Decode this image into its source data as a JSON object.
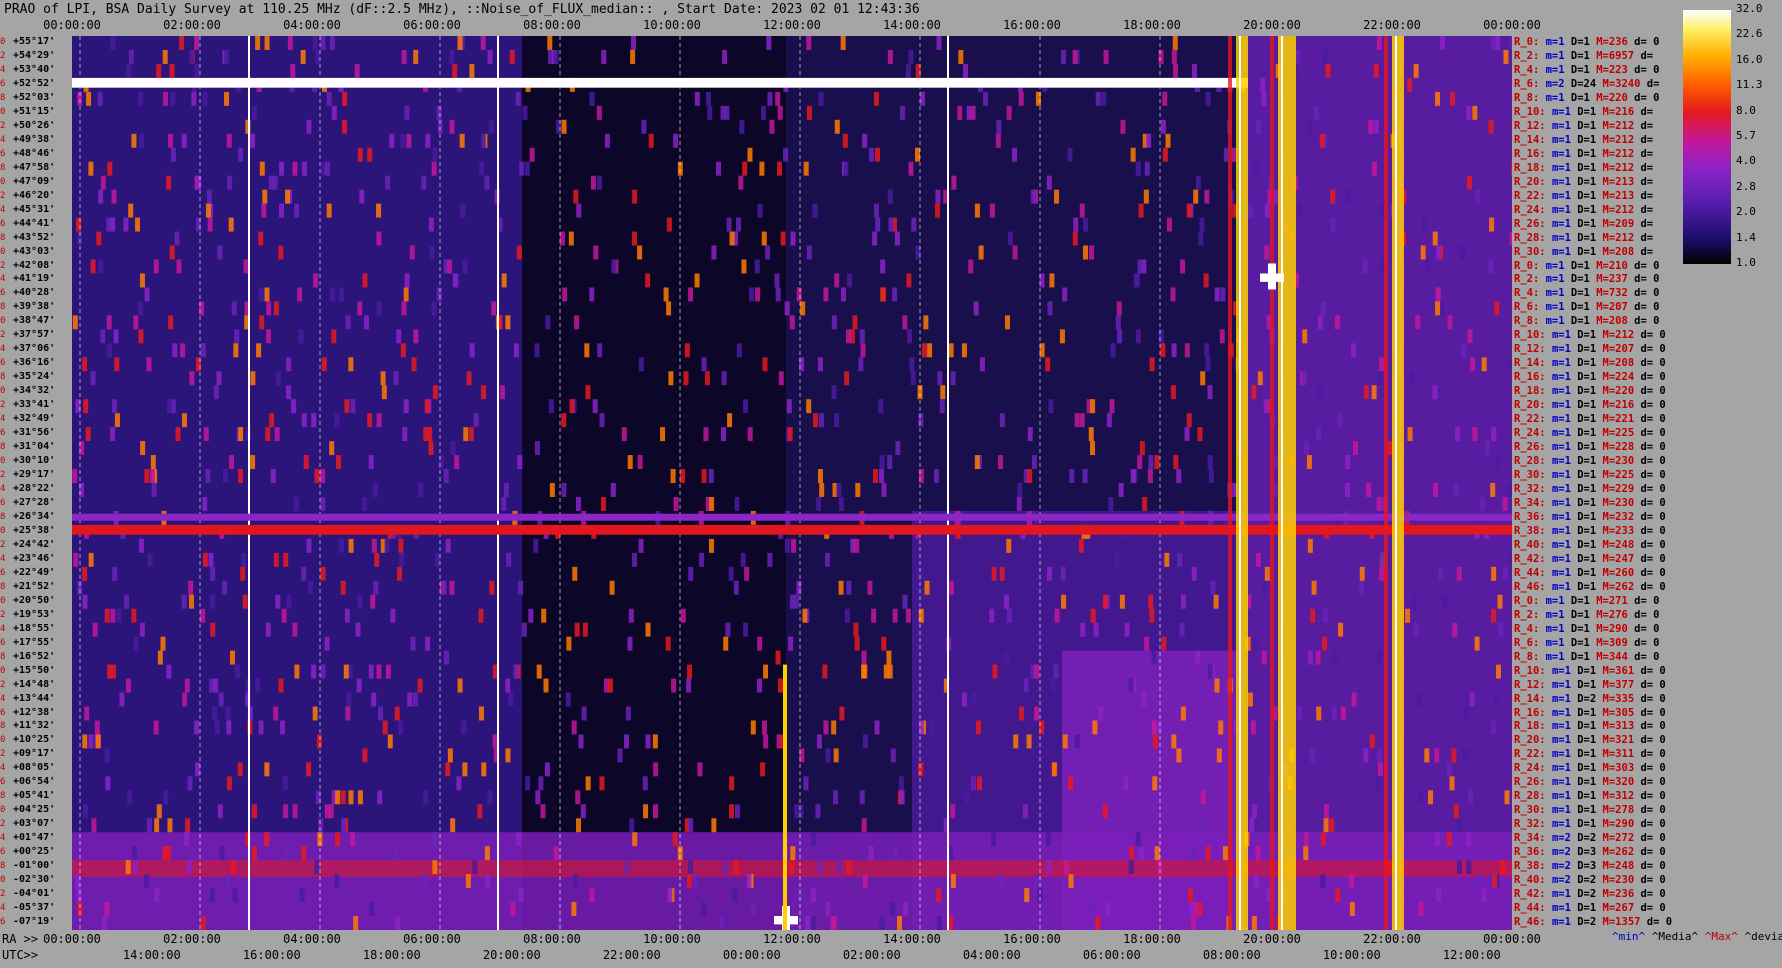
{
  "title": "PRAO of LPI, BSA Daily Survey at 110.25 MHz (dF::2.5 MHz), ::Noise_of_FLUX_median:: , Start Date: 2023 02 01 12:43:36",
  "top_ticks": [
    "00:00:00",
    "02:00:00",
    "04:00:00",
    "06:00:00",
    "08:00:00",
    "10:00:00",
    "12:00:00",
    "14:00:00",
    "16:00:00",
    "18:00:00",
    "20:00:00",
    "22:00:00",
    "00:00:00"
  ],
  "ra_label": "RA >>",
  "ra_ticks": [
    "00:00:00",
    "02:00:00",
    "04:00:00",
    "06:00:00",
    "08:00:00",
    "10:00:00",
    "12:00:00",
    "14:00:00",
    "16:00:00",
    "18:00:00",
    "20:00:00",
    "22:00:00",
    "00:00:00"
  ],
  "utc_label": "UTC>>",
  "utc_ticks": [
    "14:00:00",
    "16:00:00",
    "18:00:00",
    "20:00:00",
    "22:00:00",
    "00:00:00",
    "02:00:00",
    "04:00:00",
    "06:00:00",
    "08:00:00",
    "10:00:00",
    "12:00:00"
  ],
  "colorbar": {
    "labels": [
      "32.0",
      "22.6",
      "16.0",
      "11.3",
      "8.0",
      "5.7",
      "4.0",
      "2.8",
      "2.0",
      "1.4",
      "1.0"
    ]
  },
  "legend": {
    "min": "^min^",
    "median": "^Media^",
    "max": "^Max^",
    "dev": "^devia^"
  },
  "declinations": [
    "+55°17'",
    "+54°29'",
    "+53°40'",
    "+52°52'",
    "+52°03'",
    "+51°15'",
    "+50°26'",
    "+49°38'",
    "+48°46'",
    "+47°58'",
    "+47°09'",
    "+46°20'",
    "+45°31'",
    "+44°41'",
    "+43°52'",
    "+43°03'",
    "+42°08'",
    "+41°19'",
    "+40°28'",
    "+39°38'",
    "+38°47'",
    "+37°57'",
    "+37°06'",
    "+36°16'",
    "+35°24'",
    "+34°32'",
    "+33°41'",
    "+32°49'",
    "+31°56'",
    "+31°04'",
    "+30°10'",
    "+29°17'",
    "+28°22'",
    "+27°28'",
    "+26°34'",
    "+25°38'",
    "+24°42'",
    "+23°46'",
    "+22°49'",
    "+21°52'",
    "+20°50'",
    "+19°53'",
    "+18°55'",
    "+17°55'",
    "+16°52'",
    "+15°50'",
    "+14°48'",
    "+13°44'",
    "+12°38'",
    "+11°32'",
    "+10°25'",
    "+09°17'",
    "+08°05'",
    "+06°54'",
    "+05°41'",
    "+04°25'",
    "+03°07'",
    "+01°47'",
    "+00°25'",
    "-01°00'",
    "-02°30'",
    "-04°01'",
    "-05°37'",
    "-07°19'"
  ],
  "dec_indices": [
    "0",
    "2",
    "4",
    "6",
    "8",
    "0",
    "2",
    "4",
    "6",
    "8",
    "0",
    "2",
    "4",
    "6",
    "8",
    "0",
    "2",
    "4",
    "6",
    "8",
    "0",
    "2",
    "4",
    "6",
    "8",
    "0",
    "2",
    "4",
    "6",
    "8",
    "0",
    "2",
    "4",
    "6",
    "8",
    "0",
    "2",
    "4",
    "6",
    "8",
    "0",
    "2",
    "4",
    "6",
    "8",
    "0",
    "2",
    "4",
    "6",
    "8",
    "0",
    "2",
    "4",
    "6",
    "8",
    "0",
    "2",
    "4",
    "6",
    "8",
    "0",
    "2",
    "4",
    "6"
  ],
  "stats": [
    {
      "r": "R_0:",
      "m": "m=1",
      "d": "D=1",
      "h": "M=236",
      "dv": "d= 0"
    },
    {
      "r": "R_2:",
      "m": "m=1",
      "d": "D=1",
      "h": "M=6957",
      "dv": "d="
    },
    {
      "r": "R_4:",
      "m": "m=1",
      "d": "D=1",
      "h": "M=223",
      "dv": "d= 0"
    },
    {
      "r": "R_6:",
      "m": "m=2",
      "d": "D=24",
      "h": "M=3240",
      "dv": "d="
    },
    {
      "r": "R_8:",
      "m": "m=1",
      "d": "D=1",
      "h": "M=220",
      "dv": "d= 0"
    },
    {
      "r": "R_10:",
      "m": "m=1",
      "d": "D=1",
      "h": "M=216",
      "dv": "d="
    },
    {
      "r": "R_12:",
      "m": "m=1",
      "d": "D=1",
      "h": "M=212",
      "dv": "d="
    },
    {
      "r": "R_14:",
      "m": "m=1",
      "d": "D=1",
      "h": "M=212",
      "dv": "d="
    },
    {
      "r": "R_16:",
      "m": "m=1",
      "d": "D=1",
      "h": "M=212",
      "dv": "d="
    },
    {
      "r": "R_18:",
      "m": "m=1",
      "d": "D=1",
      "h": "M=212",
      "dv": "d="
    },
    {
      "r": "R_20:",
      "m": "m=1",
      "d": "D=1",
      "h": "M=213",
      "dv": "d="
    },
    {
      "r": "R_22:",
      "m": "m=1",
      "d": "D=1",
      "h": "M=213",
      "dv": "d="
    },
    {
      "r": "R_24:",
      "m": "m=1",
      "d": "D=1",
      "h": "M=212",
      "dv": "d="
    },
    {
      "r": "R_26:",
      "m": "m=1",
      "d": "D=1",
      "h": "M=209",
      "dv": "d="
    },
    {
      "r": "R_28:",
      "m": "m=1",
      "d": "D=1",
      "h": "M=212",
      "dv": "d="
    },
    {
      "r": "R_30:",
      "m": "m=1",
      "d": "D=1",
      "h": "M=208",
      "dv": "d="
    },
    {
      "r": "R_0:",
      "m": "m=1",
      "d": "D=1",
      "h": "M=210",
      "dv": "d= 0"
    },
    {
      "r": "R_2:",
      "m": "m=1",
      "d": "D=1",
      "h": "M=237",
      "dv": "d= 0"
    },
    {
      "r": "R_4:",
      "m": "m=1",
      "d": "D=1",
      "h": "M=732",
      "dv": "d= 0"
    },
    {
      "r": "R_6:",
      "m": "m=1",
      "d": "D=1",
      "h": "M=207",
      "dv": "d= 0"
    },
    {
      "r": "R_8:",
      "m": "m=1",
      "d": "D=1",
      "h": "M=208",
      "dv": "d= 0"
    },
    {
      "r": "R_10:",
      "m": "m=1",
      "d": "D=1",
      "h": "M=212",
      "dv": "d= 0"
    },
    {
      "r": "R_12:",
      "m": "m=1",
      "d": "D=1",
      "h": "M=207",
      "dv": "d= 0"
    },
    {
      "r": "R_14:",
      "m": "m=1",
      "d": "D=1",
      "h": "M=208",
      "dv": "d= 0"
    },
    {
      "r": "R_16:",
      "m": "m=1",
      "d": "D=1",
      "h": "M=224",
      "dv": "d= 0"
    },
    {
      "r": "R_18:",
      "m": "m=1",
      "d": "D=1",
      "h": "M=220",
      "dv": "d= 0"
    },
    {
      "r": "R_20:",
      "m": "m=1",
      "d": "D=1",
      "h": "M=216",
      "dv": "d= 0"
    },
    {
      "r": "R_22:",
      "m": "m=1",
      "d": "D=1",
      "h": "M=221",
      "dv": "d= 0"
    },
    {
      "r": "R_24:",
      "m": "m=1",
      "d": "D=1",
      "h": "M=225",
      "dv": "d= 0"
    },
    {
      "r": "R_26:",
      "m": "m=1",
      "d": "D=1",
      "h": "M=228",
      "dv": "d= 0"
    },
    {
      "r": "R_28:",
      "m": "m=1",
      "d": "D=1",
      "h": "M=230",
      "dv": "d= 0"
    },
    {
      "r": "R_30:",
      "m": "m=1",
      "d": "D=1",
      "h": "M=225",
      "dv": "d= 0"
    },
    {
      "r": "R_32:",
      "m": "m=1",
      "d": "D=1",
      "h": "M=229",
      "dv": "d= 0"
    },
    {
      "r": "R_34:",
      "m": "m=1",
      "d": "D=1",
      "h": "M=230",
      "dv": "d= 0"
    },
    {
      "r": "R_36:",
      "m": "m=1",
      "d": "D=1",
      "h": "M=232",
      "dv": "d= 0"
    },
    {
      "r": "R_38:",
      "m": "m=1",
      "d": "D=1",
      "h": "M=233",
      "dv": "d= 0"
    },
    {
      "r": "R_40:",
      "m": "m=1",
      "d": "D=1",
      "h": "M=248",
      "dv": "d= 0"
    },
    {
      "r": "R_42:",
      "m": "m=1",
      "d": "D=1",
      "h": "M=247",
      "dv": "d= 0"
    },
    {
      "r": "R_44:",
      "m": "m=1",
      "d": "D=1",
      "h": "M=260",
      "dv": "d= 0"
    },
    {
      "r": "R_46:",
      "m": "m=1",
      "d": "D=1",
      "h": "M=262",
      "dv": "d= 0"
    },
    {
      "r": "R_0:",
      "m": "m=1",
      "d": "D=1",
      "h": "M=271",
      "dv": "d= 0"
    },
    {
      "r": "R_2:",
      "m": "m=1",
      "d": "D=1",
      "h": "M=276",
      "dv": "d= 0"
    },
    {
      "r": "R_4:",
      "m": "m=1",
      "d": "D=1",
      "h": "M=290",
      "dv": "d= 0"
    },
    {
      "r": "R_6:",
      "m": "m=1",
      "d": "D=1",
      "h": "M=309",
      "dv": "d= 0"
    },
    {
      "r": "R_8:",
      "m": "m=1",
      "d": "D=1",
      "h": "M=344",
      "dv": "d= 0"
    },
    {
      "r": "R_10:",
      "m": "m=1",
      "d": "D=1",
      "h": "M=361",
      "dv": "d= 0"
    },
    {
      "r": "R_12:",
      "m": "m=1",
      "d": "D=1",
      "h": "M=377",
      "dv": "d= 0"
    },
    {
      "r": "R_14:",
      "m": "m=1",
      "d": "D=2",
      "h": "M=335",
      "dv": "d= 0"
    },
    {
      "r": "R_16:",
      "m": "m=1",
      "d": "D=1",
      "h": "M=305",
      "dv": "d= 0"
    },
    {
      "r": "R_18:",
      "m": "m=1",
      "d": "D=1",
      "h": "M=313",
      "dv": "d= 0"
    },
    {
      "r": "R_20:",
      "m": "m=1",
      "d": "D=1",
      "h": "M=321",
      "dv": "d= 0"
    },
    {
      "r": "R_22:",
      "m": "m=1",
      "d": "D=1",
      "h": "M=311",
      "dv": "d= 0"
    },
    {
      "r": "R_24:",
      "m": "m=1",
      "d": "D=1",
      "h": "M=303",
      "dv": "d= 0"
    },
    {
      "r": "R_26:",
      "m": "m=1",
      "d": "D=1",
      "h": "M=320",
      "dv": "d= 0"
    },
    {
      "r": "R_28:",
      "m": "m=1",
      "d": "D=1",
      "h": "M=312",
      "dv": "d= 0"
    },
    {
      "r": "R_30:",
      "m": "m=1",
      "d": "D=1",
      "h": "M=278",
      "dv": "d= 0"
    },
    {
      "r": "R_32:",
      "m": "m=1",
      "d": "D=1",
      "h": "M=290",
      "dv": "d= 0"
    },
    {
      "r": "R_34:",
      "m": "m=2",
      "d": "D=2",
      "h": "M=272",
      "dv": "d= 0"
    },
    {
      "r": "R_36:",
      "m": "m=2",
      "d": "D=3",
      "h": "M=262",
      "dv": "d= 0"
    },
    {
      "r": "R_38:",
      "m": "m=2",
      "d": "D=3",
      "h": "M=248",
      "dv": "d= 0"
    },
    {
      "r": "R_40:",
      "m": "m=2",
      "d": "D=2",
      "h": "M=230",
      "dv": "d= 0"
    },
    {
      "r": "R_42:",
      "m": "m=1",
      "d": "D=2",
      "h": "M=236",
      "dv": "d= 0"
    },
    {
      "r": "R_44:",
      "m": "m=1",
      "d": "D=1",
      "h": "M=267",
      "dv": "d= 0"
    },
    {
      "r": "R_46:",
      "m": "m=1",
      "d": "D=2",
      "h": "M=1357",
      "dv": "d= 0"
    }
  ],
  "chart_data": {
    "type": "heatmap",
    "title": "PRAO of LPI, BSA Daily Survey at 110.25 MHz (dF::2.5 MHz), ::Noise_of_FLUX_median:: , Start Date: 2023 02 01 12:43:36",
    "x_axis": "RA / UTC (hours)",
    "xlim": [
      0,
      24
    ],
    "y_axis": "declination beams",
    "rows": 64,
    "color_scale": [
      1.0,
      32.0
    ],
    "color_scale_labels": [
      "1.0",
      "1.4",
      "2.0",
      "2.8",
      "4.0",
      "5.7",
      "8.0",
      "11.3",
      "16.0",
      "22.6",
      "32.0"
    ],
    "bright_features": [
      {
        "name": "hot row",
        "row": 3,
        "ra_start": 0,
        "ra_end": 19.6
      },
      {
        "name": "interference row",
        "row": 35,
        "ra_start": 0,
        "ra_end": 24
      },
      {
        "name": "bright band",
        "ra_start": 19.4,
        "ra_end": 19.6
      },
      {
        "name": "bright band",
        "ra_start": 20.1,
        "ra_end": 20.4
      },
      {
        "name": "bright band",
        "ra_start": 22.0,
        "ra_end": 22.2
      },
      {
        "name": "source",
        "ra": 11.9,
        "row": 63
      },
      {
        "name": "source",
        "ra": 20.0,
        "row": 17
      }
    ],
    "colors": {
      "background": "#1a0f4d",
      "bright": "#ffffff",
      "hot": "#ffd000",
      "red": "#e3161e",
      "purple": "#8b27c6"
    }
  }
}
